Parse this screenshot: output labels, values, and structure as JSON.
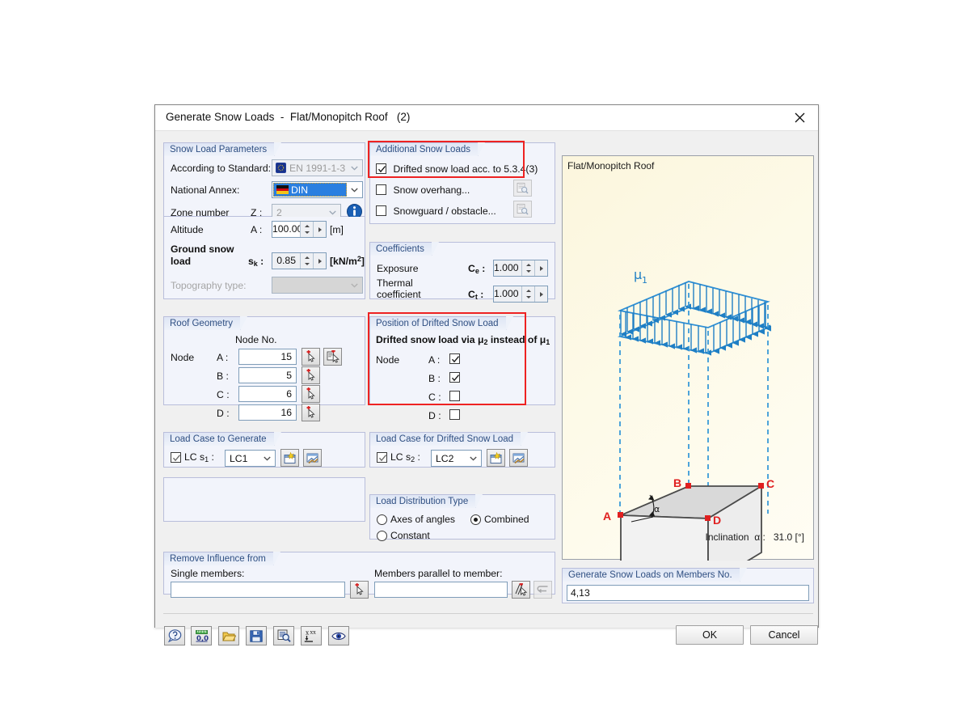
{
  "window": {
    "title": "Generate Snow Loads  -  Flat/Monopitch Roof   (2)",
    "close_icon": "close-icon"
  },
  "snow_load_parameters": {
    "legend": "Snow Load Parameters",
    "standard_label": "According to Standard:",
    "standard_value": "EN 1991-1-3",
    "national_annex_label": "National Annex:",
    "national_annex_value": "DIN",
    "zone_label": "Zone number",
    "zone_symbol": "Z :",
    "zone_value": "2",
    "info_icon": "info-icon",
    "altitude_label": "Altitude",
    "altitude_symbol": "A :",
    "altitude_value": "100.000",
    "altitude_unit": "[m]",
    "ground_snow_label_1": "Ground snow",
    "ground_snow_label_2": "load",
    "ground_snow_symbol": "s",
    "ground_snow_symbol_sub": "k",
    "ground_snow_value": "0.85",
    "ground_snow_unit_pre": "[kN/m",
    "ground_snow_unit_sup": "2",
    "ground_snow_unit_post": "]",
    "topography_label": "Topography type:",
    "topography_value": ""
  },
  "additional_snow_loads": {
    "legend": "Additional Snow Loads",
    "items": [
      {
        "label": "Drifted snow load acc. to 5.3.4(3)",
        "checked": true,
        "has_button": false
      },
      {
        "label": "Snow overhang...",
        "checked": false,
        "has_button": true
      },
      {
        "label": "Snowguard / obstacle...",
        "checked": false,
        "has_button": true
      }
    ],
    "button_icon": "magnifier-document-icon",
    "highlight_color": "#ee2222"
  },
  "coefficients": {
    "legend": "Coefficients",
    "exposure_label": "Exposure",
    "exposure_symbol": "C",
    "exposure_symbol_sub": "e",
    "exposure_value": "1.000",
    "thermal_label_1": "Thermal",
    "thermal_label_2": "coefficient",
    "thermal_symbol": "C",
    "thermal_symbol_sub": "t",
    "thermal_value": "1.000"
  },
  "roof_geometry": {
    "legend": "Roof Geometry",
    "column_header": "Node No.",
    "node_label": "Node",
    "rows": [
      {
        "label": "A :",
        "value": "15"
      },
      {
        "label": "B :",
        "value": "5"
      },
      {
        "label": "C :",
        "value": "6"
      },
      {
        "label": "D :",
        "value": "16"
      }
    ],
    "pick_icon": "pick-node-cursor-icon",
    "pick_list_icon": "pick-node-list-icon"
  },
  "position_drifted": {
    "legend": "Position of Drifted Snow Load",
    "description_pre": "Drifted snow load via ",
    "description_mu2": "μ",
    "description_mu2_sub": "2",
    "description_mid": " instead of ",
    "description_mu1": "μ",
    "description_mu1_sub": "1",
    "node_label": "Node",
    "rows": [
      {
        "label": "A :",
        "checked": true
      },
      {
        "label": "B :",
        "checked": true
      },
      {
        "label": "C :",
        "checked": false
      },
      {
        "label": "D :",
        "checked": false
      }
    ],
    "highlight_color": "#ee2222"
  },
  "load_case_generate": {
    "legend": "Load Case to Generate",
    "checkbox_checked": true,
    "label_pre": "LC s",
    "label_sub": "1",
    "label_post": " :",
    "value": "LC1",
    "new_icon": "new-load-case-icon",
    "edit_icon": "edit-load-case-icon"
  },
  "load_case_drifted": {
    "legend": "Load Case for Drifted Snow Load",
    "checkbox_checked": true,
    "label_pre": "LC s",
    "label_sub": "2",
    "label_post": " :",
    "value": "LC2",
    "new_icon": "new-load-case-icon",
    "edit_icon": "edit-load-case-icon"
  },
  "load_distribution": {
    "legend": "Load Distribution Type",
    "options": [
      {
        "label": "Axes of angles",
        "selected": false
      },
      {
        "label": "Combined",
        "selected": true
      },
      {
        "label": "Constant",
        "selected": false
      }
    ]
  },
  "remove_influence": {
    "legend": "Remove Influence from",
    "single_members_label": "Single members:",
    "single_members_value": "",
    "parallel_label": "Members parallel to member:",
    "parallel_value": "",
    "pick_icon": "pick-member-cursor-icon",
    "pick_parallel_icon": "pick-parallel-member-icon",
    "arrow_icon": "return-arrow-icon"
  },
  "preview": {
    "title": "Flat/Monopitch Roof",
    "mu_symbol": "μ",
    "mu_sub": "1",
    "alpha_symbol": "α",
    "node_labels": [
      "A",
      "B",
      "C",
      "D"
    ],
    "inclination_label_pre": "Inclination  ",
    "inclination_symbol": "α",
    "inclination_label_post": " :",
    "inclination_value": "31.0 [°]",
    "load_arrow_color": "#1f7fc4",
    "node_marker_color": "#e02020"
  },
  "members_output": {
    "legend": "Generate Snow Loads on Members No.",
    "value": "4,13"
  },
  "footer": {
    "toolbar": [
      {
        "name": "help-icon"
      },
      {
        "name": "units-icon"
      },
      {
        "name": "open-folder-icon"
      },
      {
        "name": "save-icon"
      },
      {
        "name": "preview-magnifier-icon"
      },
      {
        "name": "xxx-load-icon"
      },
      {
        "name": "visibility-eye-icon"
      }
    ],
    "ok_label": "OK",
    "cancel_label": "Cancel"
  }
}
